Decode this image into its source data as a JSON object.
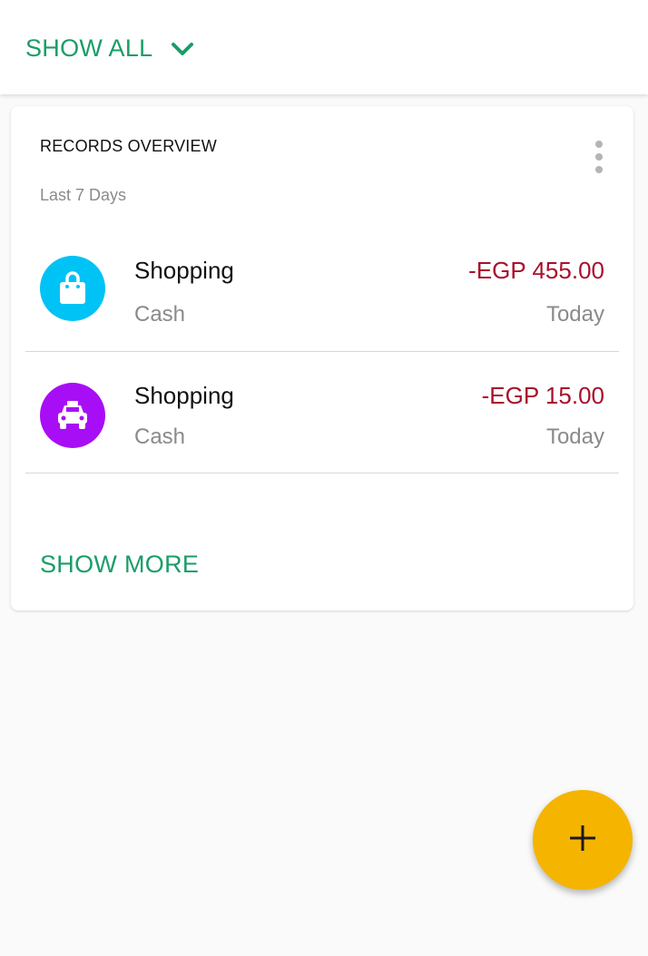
{
  "header": {
    "show_all_label": "SHOW ALL",
    "chevron_icon": "chevron-down-icon",
    "accent_color": "#1a9d68"
  },
  "card": {
    "title": "RECORDS OVERVIEW",
    "subtitle": "Last 7 Days",
    "menu_icon": "more-vert-icon",
    "records": [
      {
        "category": "Shopping",
        "account": "Cash",
        "amount": "-EGP 455.00",
        "date": "Today",
        "icon": "shopping-bag-icon",
        "icon_color": "#00c3f5"
      },
      {
        "category": "Shopping",
        "account": "Cash",
        "amount": "-EGP 15.00",
        "date": "Today",
        "icon": "taxi-icon",
        "icon_color": "#a80ef5"
      }
    ],
    "show_more_label": "SHOW MORE",
    "amount_color": "#a8102c"
  },
  "fab": {
    "icon": "plus-icon",
    "color": "#f5b400"
  }
}
